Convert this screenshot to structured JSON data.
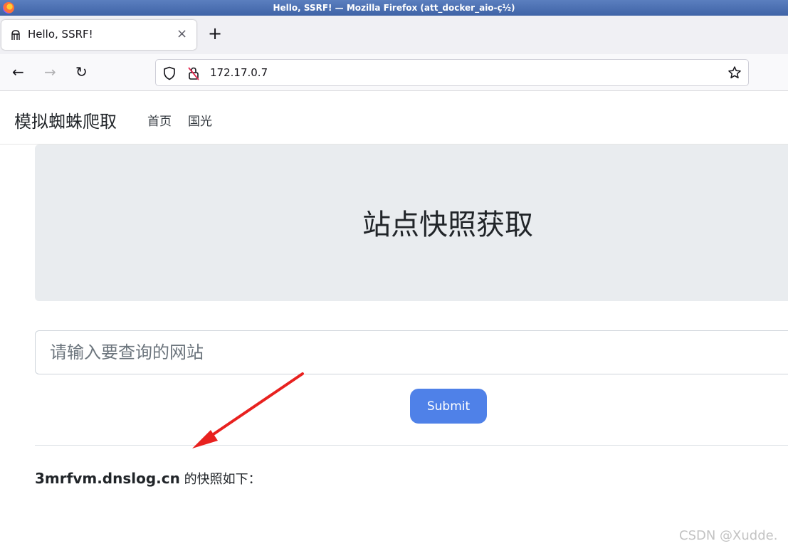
{
  "window": {
    "title": "Hello, SSRF! — Mozilla Firefox (att_docker_aio-ç½)"
  },
  "tab": {
    "title": "Hello, SSRF!",
    "close": "×",
    "new_tab": "+"
  },
  "nav": {
    "back": "←",
    "forward": "→",
    "reload": "↻",
    "url": "172.17.0.7"
  },
  "page": {
    "brand": "模拟蜘蛛爬取",
    "links": [
      "首页",
      "国光"
    ],
    "heading": "站点快照获取",
    "search_placeholder": "请输入要查询的网站",
    "submit_label": "Submit",
    "result_domain": "3mrfvm.dnslog.cn",
    "result_suffix": " 的快照如下："
  },
  "watermark": "CSDN @Xudde.",
  "colors": {
    "accent": "#4f81e8",
    "arrow": "#e8211f",
    "jumbotron": "#e9ecef"
  },
  "icons": {
    "shield": "shield-icon",
    "lock": "insecure-lock-icon",
    "star": "bookmark-star-icon"
  }
}
